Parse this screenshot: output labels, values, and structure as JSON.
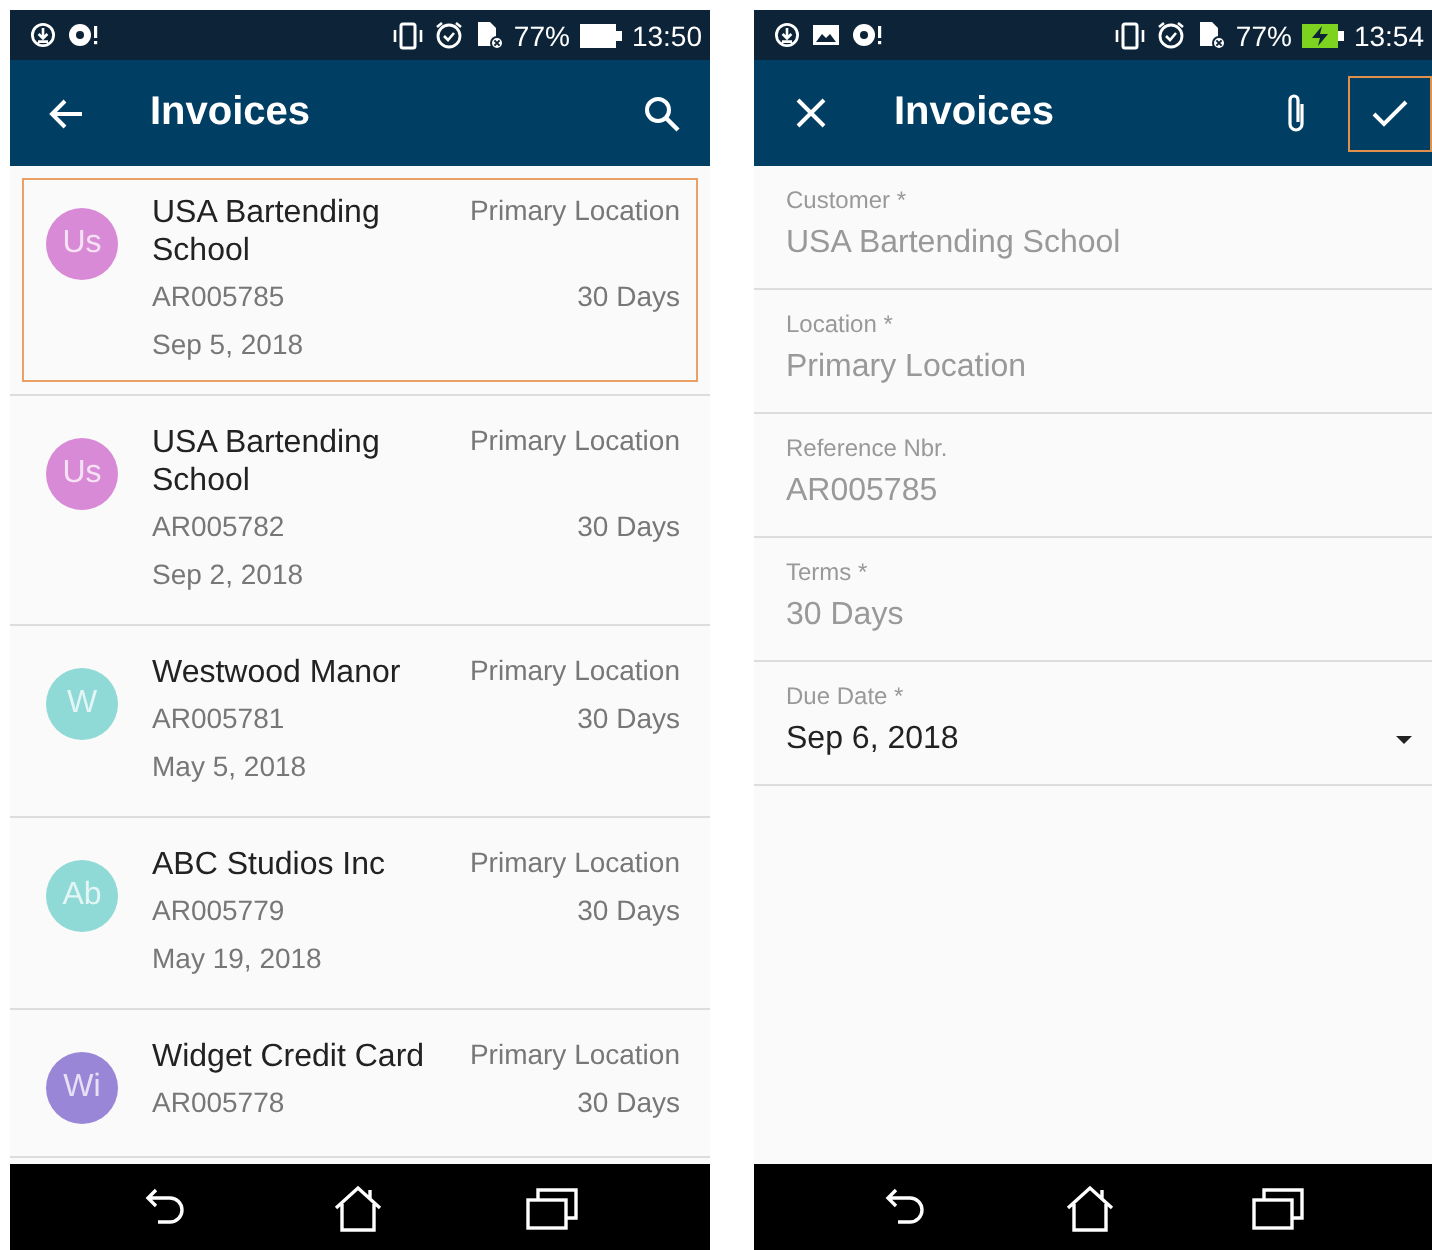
{
  "screens": [
    {
      "status_bar": {
        "time": "13:50",
        "battery": "77%",
        "charging": false,
        "extra_notification": false
      },
      "kind": "list",
      "app_bar": {
        "title": "Invoices"
      },
      "invoices": [
        {
          "initials": "Us",
          "color": "#d98ad6",
          "customer": "USA Bartending School",
          "location": "Primary Location",
          "reference": "AR005785",
          "terms": "30 Days",
          "date": "Sep 5, 2018",
          "selected": true
        },
        {
          "initials": "Us",
          "color": "#d98ad6",
          "customer": "USA Bartending School",
          "location": "Primary Location",
          "reference": "AR005782",
          "terms": "30 Days",
          "date": "Sep 2, 2018",
          "selected": false
        },
        {
          "initials": "W",
          "color": "#8fd9d6",
          "customer": "Westwood Manor",
          "location": "Primary Location",
          "reference": "AR005781",
          "terms": "30 Days",
          "date": "May 5, 2018",
          "selected": false
        },
        {
          "initials": "Ab",
          "color": "#8fd9d6",
          "customer": "ABC Studios Inc",
          "location": "Primary Location",
          "reference": "AR005779",
          "terms": "30 Days",
          "date": "May 19, 2018",
          "selected": false
        },
        {
          "initials": "Wi",
          "color": "#9a86d6",
          "customer": "Widget Credit Card",
          "location": "Primary Location",
          "reference": "AR005778",
          "terms": "30 Days",
          "selected": false
        }
      ]
    },
    {
      "status_bar": {
        "time": "13:54",
        "battery": "77%",
        "charging": true,
        "extra_notification": true
      },
      "kind": "form",
      "app_bar": {
        "title": "Invoices"
      },
      "fields": [
        {
          "label": "Customer *",
          "value": "USA Bartending School",
          "kind": "text",
          "disabled": true
        },
        {
          "label": "Location *",
          "value": "Primary Location",
          "kind": "text",
          "disabled": true
        },
        {
          "label": "Reference Nbr.",
          "value": "AR005785",
          "kind": "text",
          "disabled": true
        },
        {
          "label": "Terms *",
          "value": "30 Days",
          "kind": "text",
          "disabled": true
        },
        {
          "label": "Due Date *",
          "value": "Sep 6, 2018",
          "kind": "dropdown",
          "disabled": false
        }
      ]
    }
  ]
}
